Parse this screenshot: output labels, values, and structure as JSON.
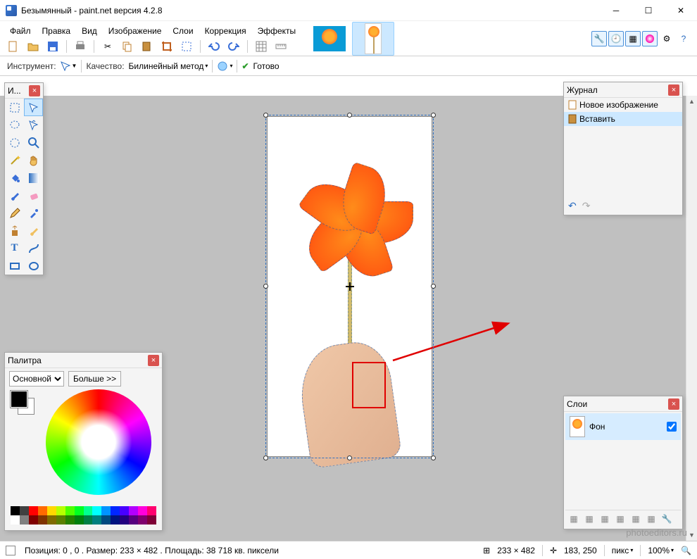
{
  "titlebar": {
    "title": "Безымянный - paint.net версия 4.2.8"
  },
  "menu": {
    "file": "Файл",
    "edit": "Правка",
    "view": "Вид",
    "image": "Изображение",
    "layers": "Слои",
    "adjustments": "Коррекция",
    "effects": "Эффекты"
  },
  "toolbar2": {
    "tool_label": "Инструмент:",
    "quality_label": "Качество:",
    "quality_value": "Билинейный метод",
    "status": "Готово"
  },
  "tools_panel": {
    "title": "И..."
  },
  "history_panel": {
    "title": "Журнал",
    "items": [
      "Новое изображение",
      "Вставить"
    ],
    "selected_index": 1
  },
  "layers_panel": {
    "title": "Слои",
    "layer_name": "Фон",
    "visible": true
  },
  "color_panel": {
    "title": "Палитра",
    "mode": "Основной",
    "more": "Больше >>",
    "primary": "#000000",
    "secondary": "#ffffff",
    "strip_row1": [
      "#000",
      "#404040",
      "#ff0000",
      "#ff6a00",
      "#ffd800",
      "#b6ff00",
      "#4cff00",
      "#00ff21",
      "#00ff90",
      "#00ffff",
      "#0094ff",
      "#0026ff",
      "#4800ff",
      "#b200ff",
      "#ff00dc",
      "#ff006e"
    ],
    "strip_row2": [
      "#fff",
      "#808080",
      "#7f0000",
      "#7f3300",
      "#7f6a00",
      "#5b7f00",
      "#267f00",
      "#007f0e",
      "#007f46",
      "#007f7f",
      "#004a7f",
      "#00137f",
      "#24007f",
      "#57007f",
      "#7f006e",
      "#7f0037"
    ]
  },
  "statusbar": {
    "position": "Позиция: 0 , 0 . Размер: 233  × 482 . Площадь: 38 718 кв. пиксели",
    "dims": "233 × 482",
    "cursor": "183, 250",
    "units": "пикс",
    "zoom": "100%"
  },
  "watermark": "photoeditors.ru"
}
